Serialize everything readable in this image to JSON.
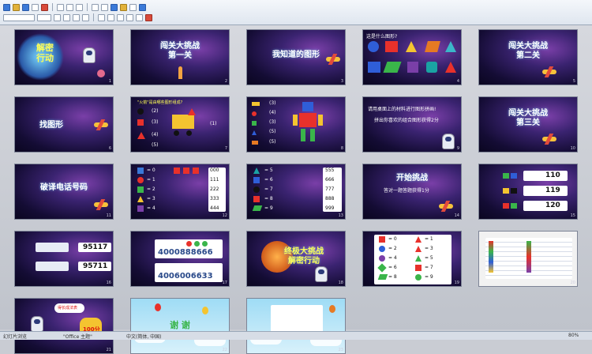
{
  "slides": [
    {
      "num": "1",
      "title": "解密\n行动"
    },
    {
      "num": "2",
      "title": "闯关大挑战\n第一关"
    },
    {
      "num": "3",
      "title": "我知道的图形"
    },
    {
      "num": "4",
      "title": "这是什么图形?"
    },
    {
      "num": "5",
      "title": "闯关大挑战\n第二关"
    },
    {
      "num": "6",
      "title": "找图形"
    },
    {
      "num": "7",
      "title": "\"火箭\"是由哪些图形组成?",
      "labels": [
        "(2)",
        "(3)",
        "(4)",
        "(5)",
        "(1)"
      ]
    },
    {
      "num": "8",
      "labels": [
        "(3)",
        "(4)",
        "(3)",
        "(5)",
        "(5)"
      ]
    },
    {
      "num": "9",
      "title": "请用桌面上的材料进行图形拼画!",
      "subtitle": "拼出你喜欢的组合图形获得2分"
    },
    {
      "num": "10",
      "title": "闯关大挑战\n第三关"
    },
    {
      "num": "11",
      "title": "破译电话号码"
    },
    {
      "num": "12",
      "items": [
        "= 0",
        "= 1",
        "= 2",
        "= 3",
        "= 4"
      ],
      "codes": [
        "000",
        "111",
        "222",
        "333",
        "444"
      ]
    },
    {
      "num": "13",
      "items": [
        "= 5",
        "= 6",
        "= 7",
        "= 8",
        "= 9"
      ],
      "codes": [
        "555",
        "666",
        "777",
        "888",
        "999"
      ]
    },
    {
      "num": "14",
      "title": "开始挑战",
      "subtitle": "答对一题答题获得1分"
    },
    {
      "num": "15",
      "answers": [
        "110",
        "119",
        "120"
      ]
    },
    {
      "num": "16",
      "answers": [
        "95117",
        "95711"
      ]
    },
    {
      "num": "17",
      "answers": [
        "4000888666",
        "4006006633"
      ]
    },
    {
      "num": "18",
      "title": "终极大挑战\n解密行动"
    },
    {
      "num": "19",
      "items": [
        "= 0",
        "= 1",
        "= 2",
        "= 3",
        "= 4",
        "= 5",
        "= 6",
        "= 7",
        "= 8",
        "= 9"
      ]
    },
    {
      "num": "20"
    },
    {
      "num": "21",
      "bubble": "得长成法表",
      "score": "100分"
    },
    {
      "num": "22",
      "title": "谢 谢"
    },
    {
      "num": "23"
    }
  ],
  "status": {
    "left": "幻灯片浏览",
    "theme": "\"Office 主题\"",
    "lang": "中文(简体, 中国)",
    "zoom": "80%"
  },
  "colors": {
    "red": "#e8312b",
    "blue": "#2f5ed8",
    "green": "#3ab54a",
    "yellow": "#f4c430",
    "purple": "#7a3fa8",
    "teal": "#1aa3a3"
  }
}
